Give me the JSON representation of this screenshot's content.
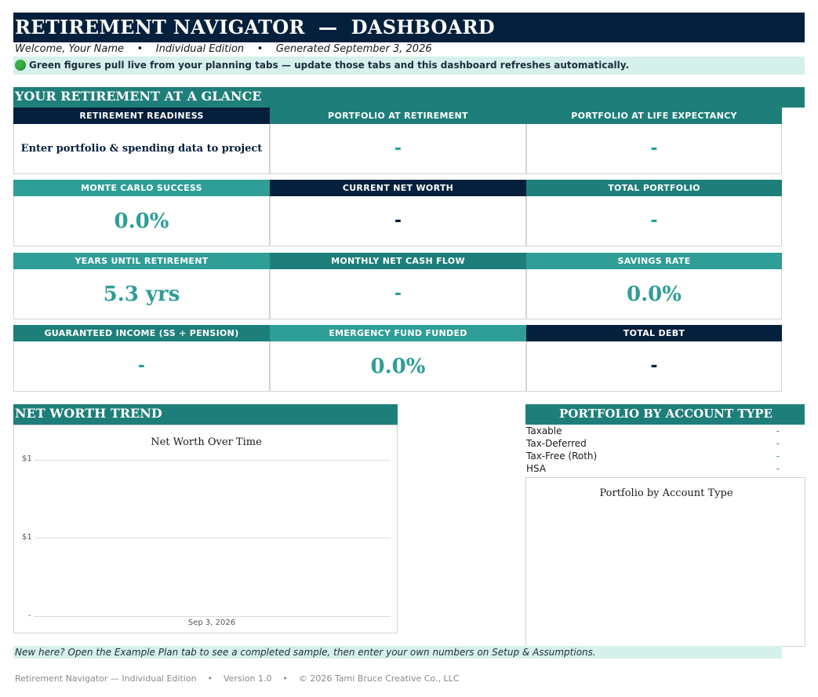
{
  "header": {
    "title": "RETIREMENT NAVIGATOR  —  DASHBOARD",
    "subtitle": "Welcome, Your Name    •    Individual Edition    •    Generated September 3, 2026",
    "notice": "Green figures pull live from your planning tabs — update those tabs and this dashboard refreshes automatically."
  },
  "glance": {
    "title": "YOUR RETIREMENT AT A GLANCE",
    "cards": [
      {
        "label": "RETIREMENT READINESS",
        "value": "Enter portfolio & spending data to project"
      },
      {
        "label": "PORTFOLIO AT RETIREMENT",
        "value": "-"
      },
      {
        "label": "PORTFOLIO AT LIFE EXPECTANCY",
        "value": "-"
      },
      {
        "label": "MONTE CARLO SUCCESS",
        "value": "0.0%"
      },
      {
        "label": "CURRENT NET WORTH",
        "value": "-"
      },
      {
        "label": "TOTAL PORTFOLIO",
        "value": "-"
      },
      {
        "label": "YEARS UNTIL RETIREMENT",
        "value": "5.3 yrs"
      },
      {
        "label": "MONTHLY NET CASH FLOW",
        "value": "-"
      },
      {
        "label": "SAVINGS RATE",
        "value": "0.0%"
      },
      {
        "label": "GUARANTEED INCOME (SS + PENSION)",
        "value": "-"
      },
      {
        "label": "EMERGENCY FUND FUNDED",
        "value": "0.0%"
      },
      {
        "label": "TOTAL DEBT",
        "value": "-"
      }
    ]
  },
  "networth": {
    "title": "NET WORTH TREND",
    "chart_title": "Net Worth Over Time",
    "y_ticks": [
      "$1",
      "$1",
      "-"
    ],
    "x_tick": "Sep 3, 2026"
  },
  "portfolio": {
    "title": "PORTFOLIO BY ACCOUNT TYPE",
    "accounts": [
      {
        "name": "Taxable",
        "value": "-"
      },
      {
        "name": "Tax-Deferred",
        "value": "-"
      },
      {
        "name": "Tax-Free (Roth)",
        "value": "-"
      },
      {
        "name": "HSA",
        "value": "-"
      }
    ],
    "chart_title": "Portfolio by Account Type"
  },
  "hint": "New here? Open the Example Plan tab to see a completed sample, then enter your own numbers on Setup & Assumptions.",
  "footer": "Retirement Navigator — Individual Edition    •    Version 1.0    •    © 2026 Tami Bruce Creative Co., LLC",
  "colors": {
    "navy": "#04203c",
    "teal": "#1e7f7a",
    "light_teal": "#2e9e96",
    "mint": "#d6f0ec",
    "status_green": "#3cb043"
  }
}
